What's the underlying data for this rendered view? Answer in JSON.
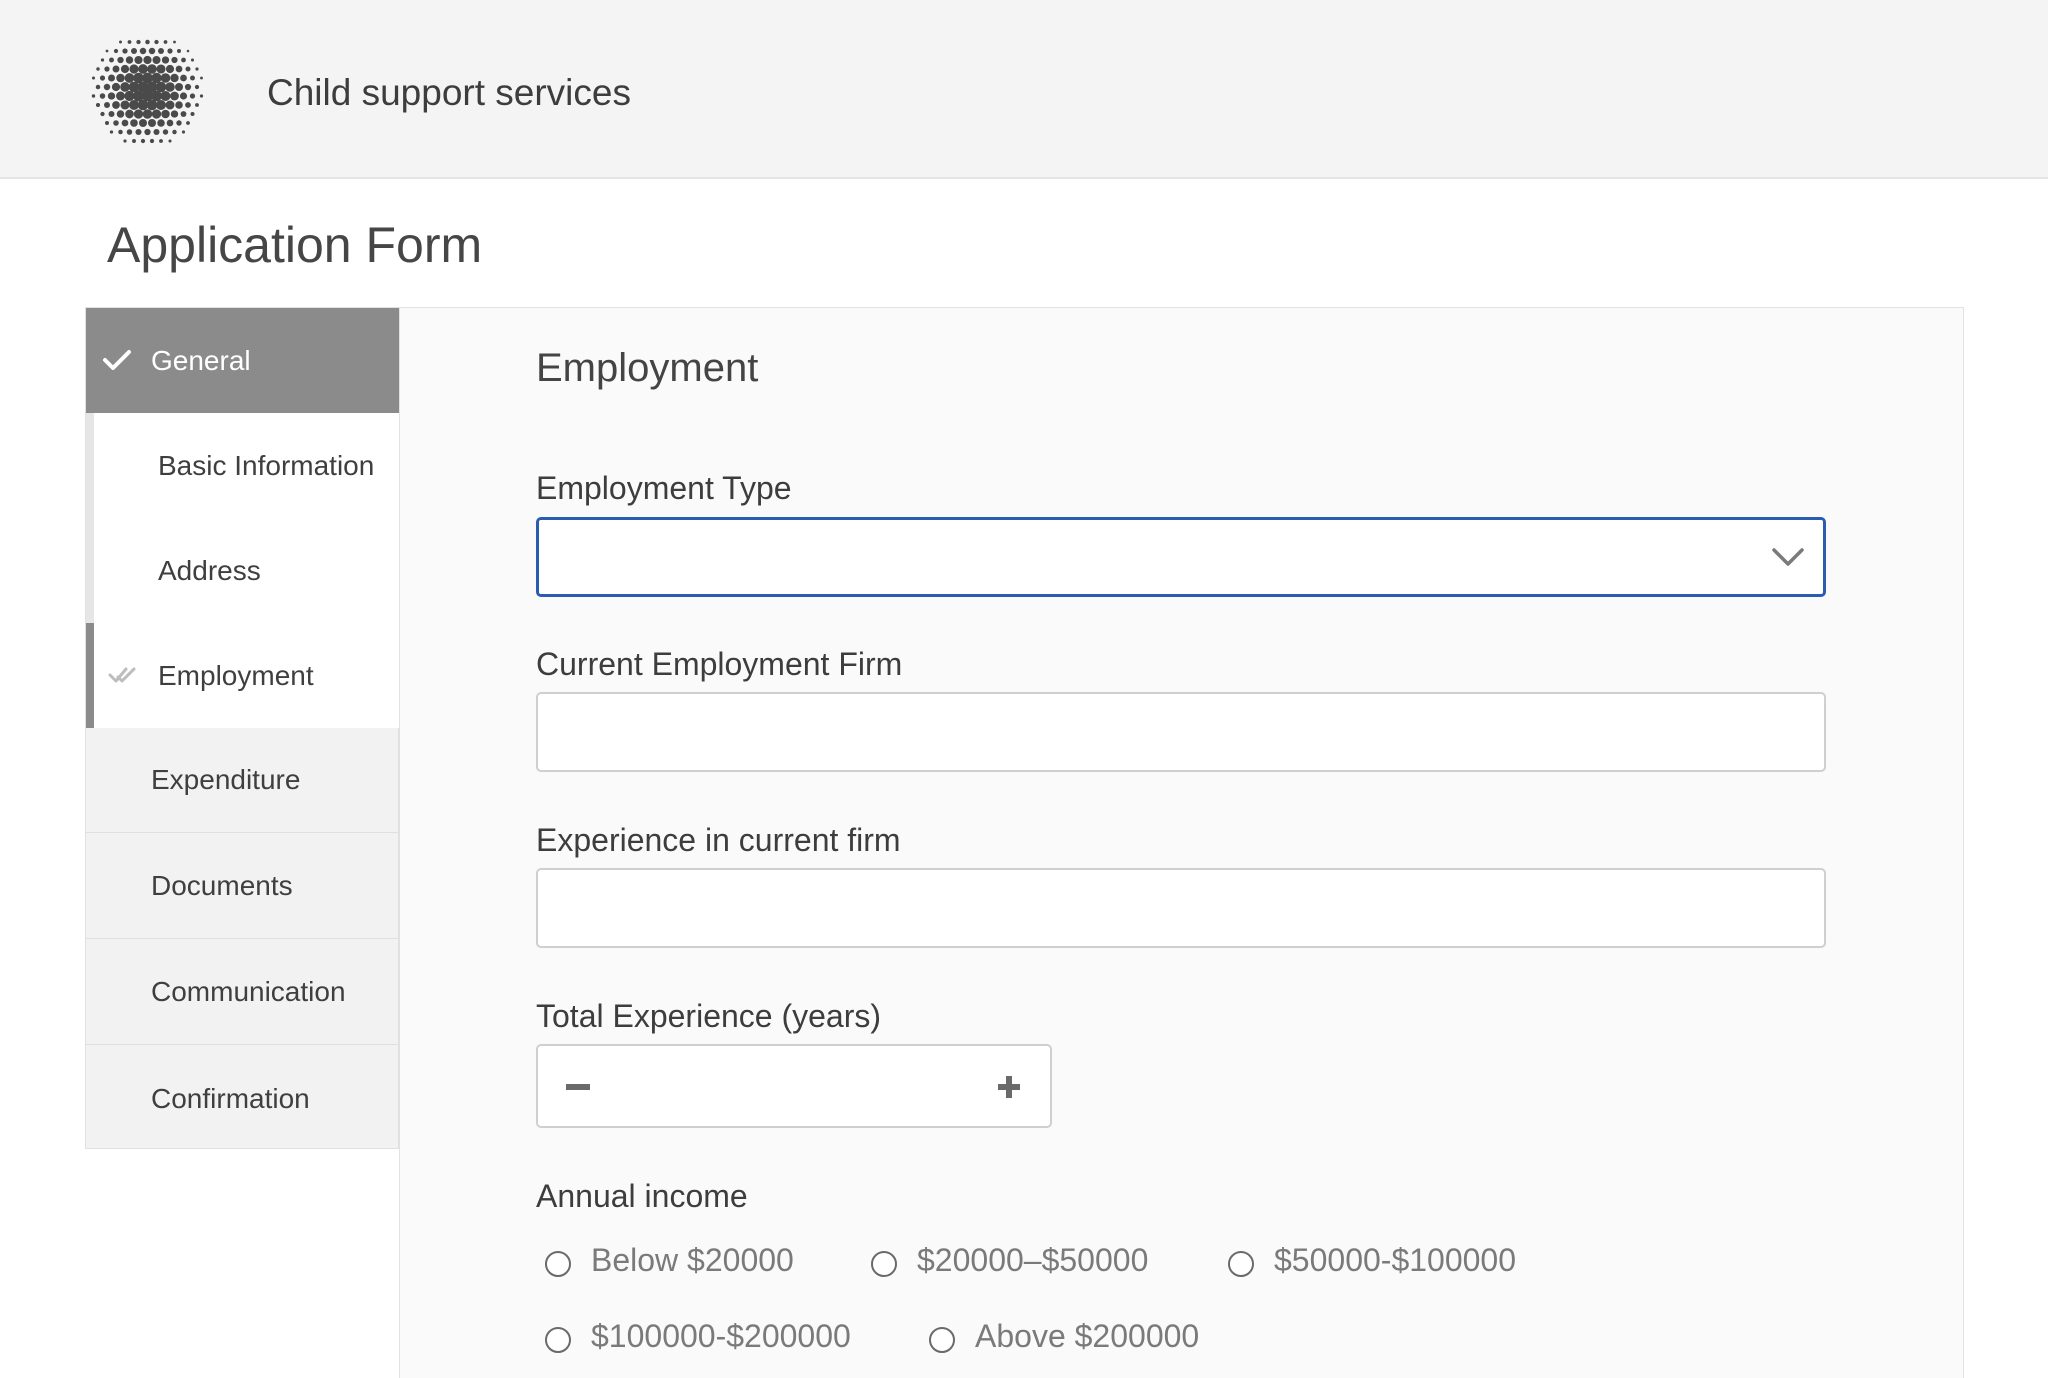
{
  "header": {
    "app_title": "Child support services"
  },
  "page": {
    "title": "Application Form"
  },
  "sidebar": {
    "general_label": "General",
    "sub_items": [
      "Basic Information",
      "Address",
      "Employment"
    ],
    "top_items": [
      "Expenditure",
      "Documents",
      "Communication",
      "Confirmation"
    ]
  },
  "form": {
    "section_title": "Employment",
    "employment_type": {
      "label": "Employment Type",
      "value": ""
    },
    "current_firm": {
      "label": "Current Employment Firm",
      "value": ""
    },
    "experience_current": {
      "label": "Experience in current firm",
      "value": ""
    },
    "total_experience": {
      "label": "Total Experience (years)",
      "value": ""
    },
    "annual_income": {
      "label": "Annual income",
      "options": [
        "Below $20000",
        "$20000–$50000",
        "$50000-$100000",
        "$100000-$200000",
        "Above $200000"
      ]
    }
  },
  "colors": {
    "accent_focus": "#2a5db0",
    "nav_active": "#8b8b8b"
  }
}
